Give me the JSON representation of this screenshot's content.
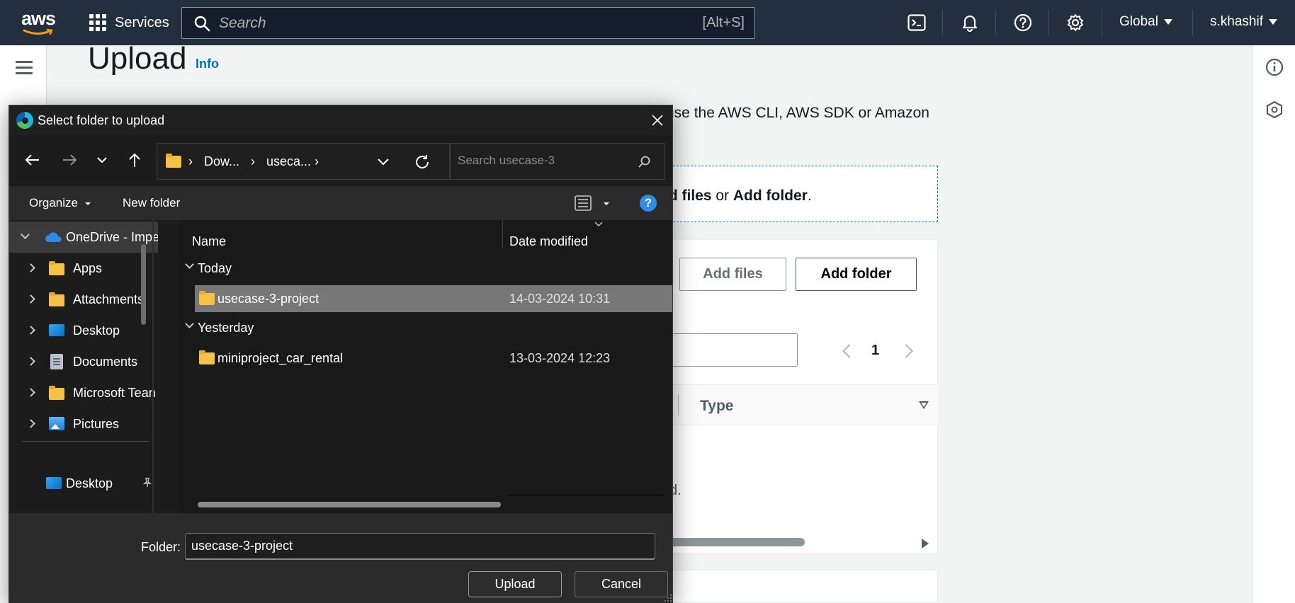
{
  "topbar": {
    "logo_text": "aws",
    "services_label": "Services",
    "search_placeholder": "Search",
    "search_hint": "[Alt+S]",
    "region": "Global",
    "user": "s.khashif",
    "icons": [
      "cloudshell-icon",
      "bell-icon",
      "help-icon",
      "gear-icon"
    ]
  },
  "page": {
    "title": "Upload",
    "info_link": "Info",
    "description_fragment": "use the AWS CLI, AWS SDK or Amazon",
    "dropzone": {
      "text_part1": "dd files",
      "text_or": " or ",
      "text_part2": "Add folder",
      "text_end": "."
    },
    "add_files_label": "Add files",
    "add_folder_label": "Add folder",
    "pager_current": "1",
    "type_column": "Type",
    "empty_fragment": "d."
  },
  "dialog": {
    "title": "Select folder to upload",
    "address_segments": [
      "Dow...",
      "useca..."
    ],
    "search_placeholder": "Search usecase-3",
    "organize_label": "Organize",
    "new_folder_label": "New folder",
    "help_label": "?",
    "nav_items": [
      {
        "label": "OneDrive - Impe",
        "icon": "onedrive-icon"
      },
      {
        "label": "Apps",
        "icon": "folder-icon"
      },
      {
        "label": "Attachments",
        "icon": "folder-icon"
      },
      {
        "label": "Desktop",
        "icon": "desktop-icon"
      },
      {
        "label": "Documents",
        "icon": "documents-icon"
      },
      {
        "label": "Microsoft Tean",
        "icon": "folder-icon"
      },
      {
        "label": "Pictures",
        "icon": "pictures-icon"
      },
      {
        "label": "Desktop",
        "icon": "desktop-icon"
      }
    ],
    "columns": {
      "name": "Name",
      "date": "Date modified"
    },
    "groups": [
      {
        "label": "Today",
        "files": [
          {
            "name": "usecase-3-project",
            "date": "14-03-2024 10:31",
            "selected": true
          }
        ]
      },
      {
        "label": "Yesterday",
        "files": [
          {
            "name": "miniproject_car_rental",
            "date": "13-03-2024 12:23",
            "selected": false
          }
        ]
      }
    ],
    "folder_label": "Folder:",
    "folder_value": "usecase-3-project",
    "upload_label": "Upload",
    "cancel_label": "Cancel"
  }
}
